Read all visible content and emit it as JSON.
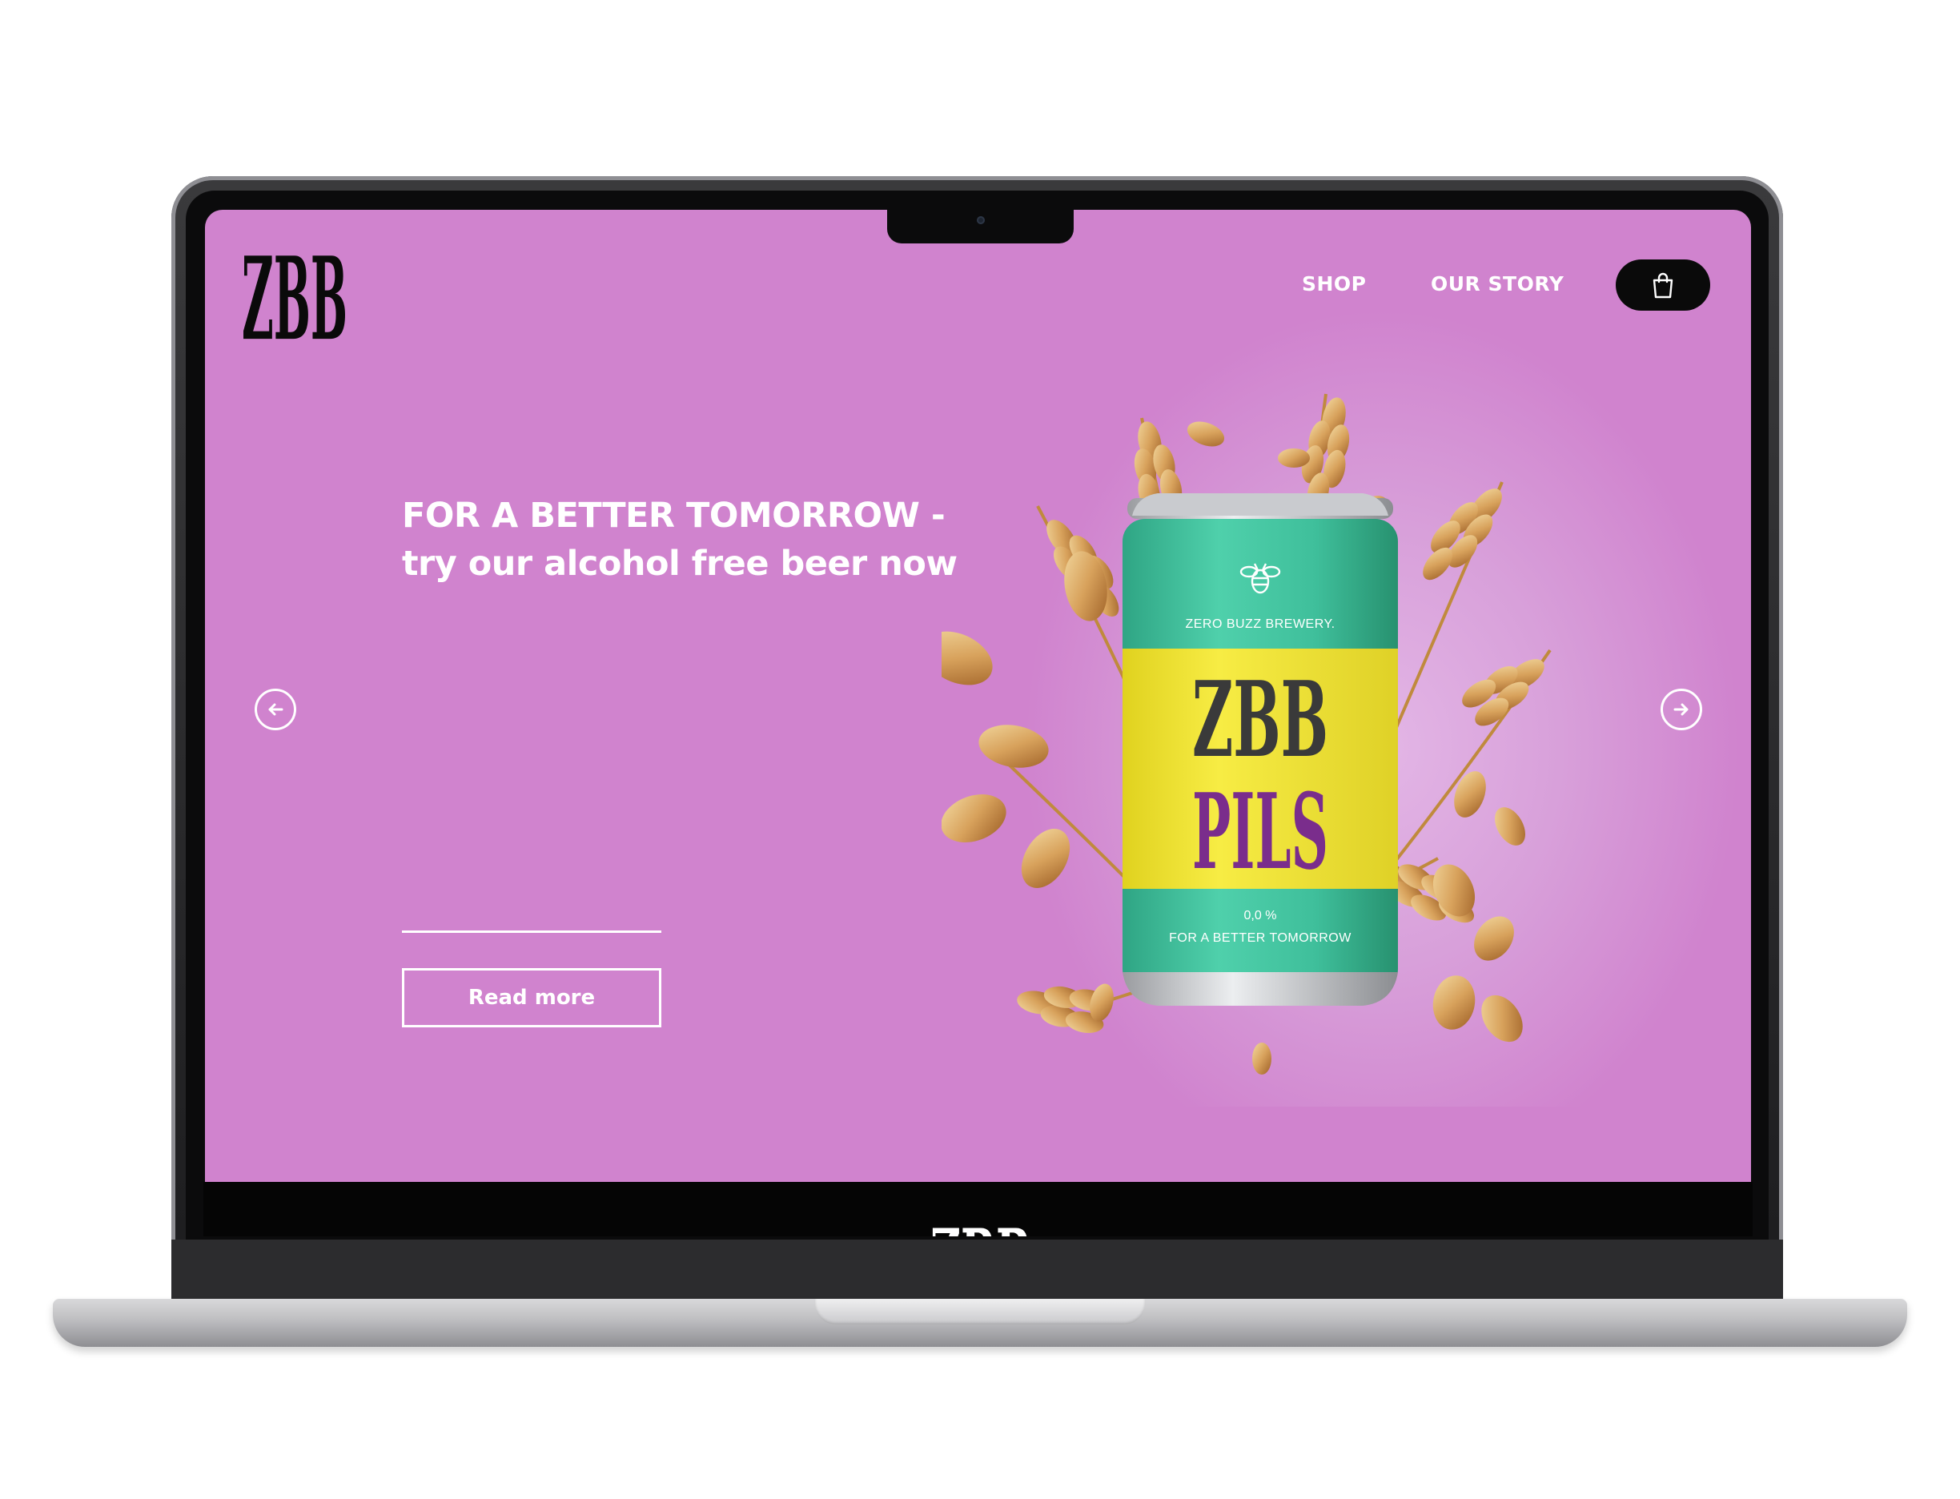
{
  "brand": {
    "logo_text": "ZBB",
    "background_color": "#d083ce",
    "accent_dark": "#0a0a0a"
  },
  "nav": {
    "items": [
      {
        "label": "SHOP"
      },
      {
        "label": "OUR STORY"
      }
    ],
    "cart_icon": "shopping-bag-icon"
  },
  "hero": {
    "headline_line1": "FOR A BETTER TOMORROW -",
    "headline_line2": "try our alcohol free beer now",
    "cta_label": "Read more",
    "prev_icon": "arrow-left-icon",
    "next_icon": "arrow-right-icon"
  },
  "product": {
    "brewery": "ZERO BUZZ BREWERY.",
    "name_line1": "ZBB",
    "name_line2": "PILS",
    "abv": "0,0 %",
    "tagline": "FOR A BETTER TOMORROW",
    "can_color": "#3fbf9b",
    "label_color": "#f2e633",
    "name_line1_color": "#3a3a3a",
    "name_line2_color": "#7a2d8c",
    "emblem_icon": "bee-icon"
  },
  "footer": {
    "logo_text": "ZBB"
  }
}
